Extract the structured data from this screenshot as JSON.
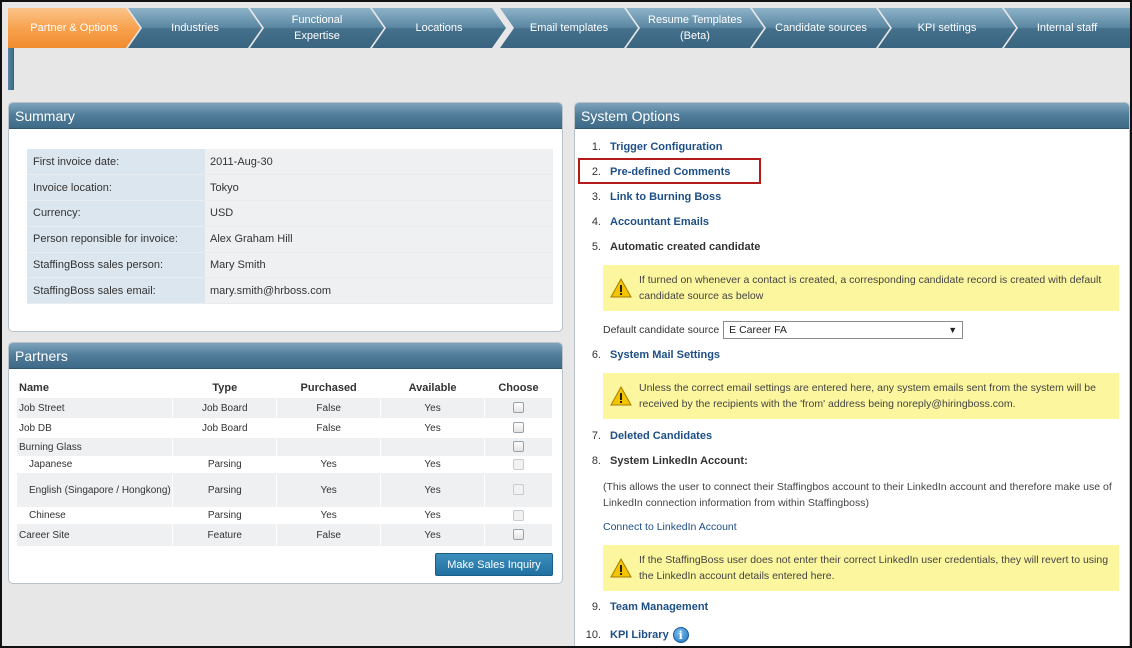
{
  "tabs": [
    {
      "label": "Partner & Options",
      "active": true
    },
    {
      "label": "Industries"
    },
    {
      "label": "Functional\nExpertise"
    },
    {
      "label": "Locations"
    },
    {
      "label": "Email templates"
    },
    {
      "label": "Resume Templates\n(Beta)"
    },
    {
      "label": "Candidate sources"
    },
    {
      "label": "KPI settings"
    },
    {
      "label": "Internal staff"
    }
  ],
  "summary": {
    "title": "Summary",
    "rows": [
      {
        "key": "First invoice date:",
        "value": "2011-Aug-30"
      },
      {
        "key": "Invoice location:",
        "value": "Tokyo"
      },
      {
        "key": "Currency:",
        "value": "USD"
      },
      {
        "key": "Person reponsible for invoice:",
        "value": "Alex Graham Hill"
      },
      {
        "key": "StaffingBoss sales person:",
        "value": "Mary Smith"
      },
      {
        "key": "StaffingBoss sales email:",
        "value": "mary.smith@hrboss.com"
      }
    ]
  },
  "partners": {
    "title": "Partners",
    "headers": {
      "name": "Name",
      "type": "Type",
      "purchased": "Purchased",
      "available": "Available",
      "choose": "Choose"
    },
    "rows": [
      {
        "name": "Job Street",
        "type": "Job Board",
        "purchased": "False",
        "available": "Yes",
        "sub": false,
        "disabled": false
      },
      {
        "name": "Job DB",
        "type": "Job Board",
        "purchased": "False",
        "available": "Yes",
        "sub": false,
        "disabled": false
      },
      {
        "name": "Burning Glass",
        "type": "",
        "purchased": "",
        "available": "",
        "sub": false,
        "disabled": false
      },
      {
        "name": "Japanese",
        "type": "Parsing",
        "purchased": "Yes",
        "available": "Yes",
        "sub": true,
        "disabled": true
      },
      {
        "name": "English (Singapore / Hongkong)",
        "type": "Parsing",
        "purchased": "Yes",
        "available": "Yes",
        "sub": true,
        "disabled": true
      },
      {
        "name": "Chinese",
        "type": "Parsing",
        "purchased": "Yes",
        "available": "Yes",
        "sub": true,
        "disabled": true
      },
      {
        "name": "Career Site",
        "type": "Feature",
        "purchased": "False",
        "available": "Yes",
        "sub": false,
        "disabled": false
      }
    ],
    "button_label": "Make Sales Inquiry"
  },
  "system_options": {
    "title": "System Options",
    "items": {
      "1": {
        "num": "1.",
        "label": "Trigger Configuration"
      },
      "2": {
        "num": "2.",
        "label": "Pre-defined Comments"
      },
      "3": {
        "num": "3.",
        "label": "Link to Burning Boss"
      },
      "4": {
        "num": "4.",
        "label": "Accountant Emails"
      },
      "5": {
        "num": "5.",
        "label": "Automatic created candidate"
      },
      "6": {
        "num": "6.",
        "label": "System Mail Settings"
      },
      "7": {
        "num": "7.",
        "label": "Deleted Candidates"
      },
      "8": {
        "num": "8.",
        "label": "System LinkedIn Account:"
      },
      "9": {
        "num": "9.",
        "label": "Team Management"
      },
      "10": {
        "num": "10.",
        "label": "KPI Library"
      }
    },
    "warn_auto": "If turned on whenever a contact is created, a corresponding candidate record is created with default candidate source as below",
    "default_source_label": "Default candidate source",
    "default_source_value": "E Career  FA",
    "warn_mail": "Unless the correct email settings are entered here, any system emails sent from the system will be received by the recipients with the 'from' address being noreply@hiringboss.com.",
    "linkedin_desc": "(This allows the user to connect their Staffingbos account to their LinkedIn account and therefore make use of LinkedIn connection information from within Staffingboss)",
    "linkedin_link": "Connect to LinkedIn Account",
    "warn_linkedin": "If the StaffingBoss user does not enter their correct LinkedIn user credentials, they will revert to using the LinkedIn account details entered here."
  }
}
